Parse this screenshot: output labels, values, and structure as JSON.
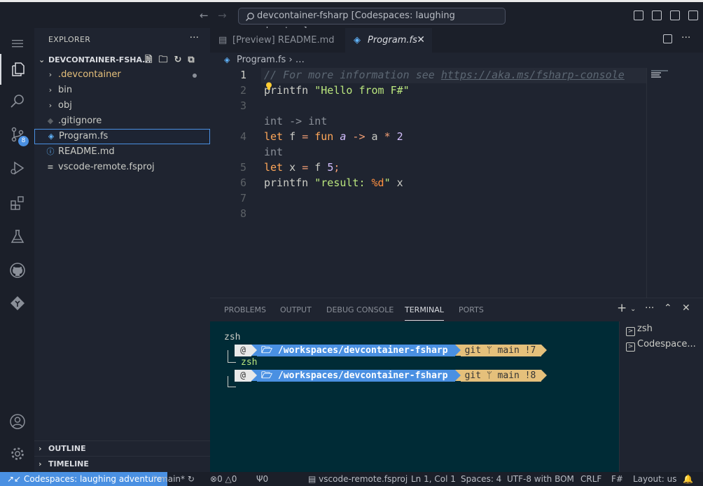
{
  "title_bar": {
    "back_icon": "arrow-left-icon",
    "forward_icon": "arrow-right-icon",
    "command_center": "devcontainer-fsharp [Codespaces: laughing adventure]"
  },
  "activity_bar": {
    "items": [
      "explorer",
      "search",
      "source-control",
      "run-and-debug",
      "extensions",
      "testing",
      "github",
      "git"
    ],
    "source_control_badge": "8"
  },
  "sidebar": {
    "title": "EXPLORER",
    "more": "···",
    "folder": "DEVCONTAINER-FSHA...",
    "tree": [
      {
        "label": ".devcontainer",
        "kind": "folder",
        "modified": true
      },
      {
        "label": "bin",
        "kind": "folder"
      },
      {
        "label": "obj",
        "kind": "folder"
      },
      {
        "label": ".gitignore",
        "kind": "file"
      },
      {
        "label": "Program.fs",
        "kind": "file",
        "selected": true
      },
      {
        "label": "README.md",
        "kind": "file"
      },
      {
        "label": "vscode-remote.fsproj",
        "kind": "file"
      }
    ],
    "outline": "OUTLINE",
    "timeline": "TIMELINE"
  },
  "tabs": [
    {
      "label": "[Preview] README.md",
      "active": false
    },
    {
      "label": "Program.fs",
      "active": true
    }
  ],
  "breadcrumb": {
    "file": "Program.fs",
    "rest": "› …"
  },
  "editor": {
    "line_numbers": [
      "1",
      "2",
      "3",
      "4",
      "5",
      "6",
      "7",
      "8"
    ],
    "line1_comment": "// For more information see ",
    "line1_url": "https://aka.ms/fsharp-console",
    "line2_fn": "printfn ",
    "line2_str": "\"Hello from F#\"",
    "codelens_1": "int -> int",
    "line4_let": "let",
    "line4_rest1": " f ",
    "line4_eq": "=",
    "line4_fun": " fun ",
    "line4_a": "a",
    "line4_arrow": " ->",
    "line4_rest2": " a ",
    "line4_star": "*",
    "line4_num": " 2",
    "codelens_2": "int",
    "line5_let": "let",
    "line5_rest1": " x ",
    "line5_eq": "=",
    "line5_rest2": " f ",
    "line5_num": "5",
    "line5_semi": ";",
    "line6_fn": "printfn ",
    "line6_str1": "\"result: ",
    "line6_fmt": "%d",
    "line6_str2": "\"",
    "line6_rest": " x"
  },
  "panel": {
    "tabs": [
      "PROBLEMS",
      "OUTPUT",
      "DEBUG CONSOLE",
      "TERMINAL",
      "PORTS"
    ],
    "active_tab": "TERMINAL",
    "terminal": {
      "line1": "zsh",
      "prompt1_path": "🗁 /workspaces/devcontainer-fsharp",
      "prompt1_git": "git ᛘ main !7",
      "line2": "zsh",
      "prompt2_path": "🗁 /workspaces/devcontainer-fsharp",
      "prompt2_git": "git ᛘ main !8"
    },
    "terminal_list": [
      "zsh",
      "Codespace..."
    ]
  },
  "status_bar": {
    "remote": "Codespaces: laughing adventure",
    "branch": "main*",
    "errors": "0",
    "warnings": "0",
    "ports": "0",
    "project": "vscode-remote.fsproj",
    "position": "Ln 1, Col 1",
    "spaces": "Spaces: 4",
    "encoding": "UTF-8 with BOM",
    "eol": "CRLF",
    "language": "F#",
    "layout": "Layout: us"
  },
  "colors": {
    "accent": "#4a90e2",
    "background": "#1f2430",
    "terminal_bg": "#002b36",
    "git_segment": "#e5c07b"
  }
}
